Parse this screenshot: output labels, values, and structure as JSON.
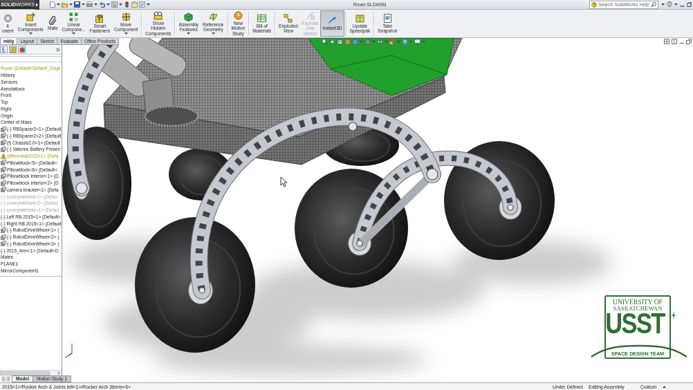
{
  "title_bar": {
    "logo": "**SOLID**WORKS",
    "title": "Rover.SLDASM",
    "search": {
      "placeholder": "Search SolidWorks Help"
    }
  },
  "command_groups": [
    [
      {
        "label": "it\nonent",
        "dropdown": false,
        "disabled": false,
        "selected": false
      },
      {
        "label": "Insert\nComponents",
        "dropdown": true,
        "disabled": false,
        "selected": false
      },
      {
        "label": "Mate",
        "dropdown": false,
        "disabled": false,
        "selected": false
      },
      {
        "label": "Linear\nCompone...",
        "dropdown": true,
        "disabled": false,
        "selected": false
      },
      {
        "label": "Smart\nFasteners",
        "dropdown": false,
        "disabled": false,
        "selected": false
      },
      {
        "label": "Move\nComponent",
        "dropdown": true,
        "disabled": false,
        "selected": false
      }
    ],
    [
      {
        "label": "Show\nHidden\nComponents",
        "dropdown": false,
        "disabled": false,
        "selected": false
      }
    ],
    [
      {
        "label": "Assembly\nFeatures",
        "dropdown": true,
        "disabled": false,
        "selected": false
      },
      {
        "label": "Reference\nGeometry",
        "dropdown": true,
        "disabled": false,
        "selected": false
      }
    ],
    [
      {
        "label": "New\nMotion\nStudy",
        "dropdown": false,
        "disabled": false,
        "selected": false
      }
    ],
    [
      {
        "label": "Bill of\nMaterials",
        "dropdown": false,
        "disabled": false,
        "selected": false
      }
    ],
    [
      {
        "label": "Exploded\nView",
        "dropdown": false,
        "disabled": false,
        "selected": false
      },
      {
        "label": "Explode\nLine\nSketch",
        "dropdown": false,
        "disabled": true,
        "selected": false
      },
      {
        "label": "Instant3D",
        "dropdown": false,
        "disabled": false,
        "selected": true
      }
    ],
    [
      {
        "label": "Update\nSpeedpak",
        "dropdown": false,
        "disabled": false,
        "selected": false
      }
    ],
    [
      {
        "label": "Take\nSnapshot",
        "dropdown": false,
        "disabled": false,
        "selected": false
      }
    ]
  ],
  "command_tabs": [
    {
      "label": "mbly",
      "selected": true
    },
    {
      "label": "Layout",
      "selected": false
    },
    {
      "label": "Sketch",
      "selected": false
    },
    {
      "label": "Evaluate",
      "selected": false
    },
    {
      "label": "Office Products",
      "selected": false
    }
  ],
  "feature_tree": {
    "items": [
      {
        "label": "Rover (Default<Default_Displ",
        "kind": "assembly",
        "suppressed": false
      },
      {
        "label": "History",
        "kind": "plain",
        "suppressed": false
      },
      {
        "label": "Sensors",
        "kind": "plain",
        "suppressed": false
      },
      {
        "label": "Annotations",
        "kind": "plain",
        "suppressed": false
      },
      {
        "label": "Front",
        "kind": "plain",
        "suppressed": false
      },
      {
        "label": "Top",
        "kind": "plain",
        "suppressed": false
      },
      {
        "label": "Right",
        "kind": "plain",
        "suppressed": false
      },
      {
        "label": "Origin",
        "kind": "plain",
        "suppressed": false
      },
      {
        "label": "Center of Mass",
        "kind": "plain",
        "suppressed": false
      },
      {
        "label": "(-) RBSpacer2<1> (Default",
        "kind": "component",
        "suppressed": false
      },
      {
        "label": "(-) RBSpacer2<2> (Default",
        "kind": "component",
        "suppressed": false
      },
      {
        "label": "(f) Chassis2.0<1> (Default",
        "kind": "component",
        "suppressed": false
      },
      {
        "label": "(-) Valence Battery Presen",
        "kind": "component",
        "suppressed": false
      },
      {
        "label": "differential2015<1> (Defa",
        "kind": "warning",
        "suppressed": false
      },
      {
        "label": "Pillowblock<5> (Default<",
        "kind": "component",
        "suppressed": false
      },
      {
        "label": "Pillowblock<6> (Default<",
        "kind": "component",
        "suppressed": false
      },
      {
        "label": "Pillowblock interior<1> (D",
        "kind": "component",
        "suppressed": false
      },
      {
        "label": "Pillowblock interior<2> (D",
        "kind": "component",
        "suppressed": false
      },
      {
        "label": "camera bracket<1> (Defa",
        "kind": "component",
        "suppressed": false
      },
      {
        "label": "(-) coverplatefwd<1> (Defau",
        "kind": "plain",
        "suppressed": true
      },
      {
        "label": "(-) coverplatefwd<2> (Defau",
        "kind": "plain",
        "suppressed": true
      },
      {
        "label": "(-) coverplateside<1> (Defau",
        "kind": "plain",
        "suppressed": true
      },
      {
        "label": "(-) Left RB 2015<1> (Default<",
        "kind": "plain",
        "suppressed": false
      },
      {
        "label": "(-) Right RB 2015<1> (Default",
        "kind": "plain",
        "suppressed": false
      },
      {
        "label": "(-) RobotDriveWheel<1> (",
        "kind": "component",
        "suppressed": false
      },
      {
        "label": "(-) RobotDriveWheel<2> (",
        "kind": "component",
        "suppressed": false
      },
      {
        "label": "(-) RobotDriveWheel<3> (",
        "kind": "component",
        "suppressed": false
      },
      {
        "label": "(-) 2015_Arm<1> (Default<D",
        "kind": "plain",
        "suppressed": false
      },
      {
        "label": "Mates",
        "kind": "plain",
        "suppressed": false
      },
      {
        "label": "PLANE1",
        "kind": "plain",
        "suppressed": false
      },
      {
        "label": "MirrorComponent1",
        "kind": "plain",
        "suppressed": false
      }
    ]
  },
  "document_tabs": [
    {
      "label": "Model",
      "selected": true
    },
    {
      "label": "Motion Study 1",
      "selected": false
    }
  ],
  "overlay_logo": {
    "lines": [
      "UNIVERSITY OF",
      "SASKATCHEWAN"
    ],
    "wordmark": "USST",
    "tagline": "SPACE DESIGN TEAM"
  },
  "status_bar": {
    "path": "2015<1>/Rocker Arch & Joints left<1>/Rocker Arch 36mm<6>",
    "fields": [
      "Under Defined",
      "Editing Assembly",
      "Custom"
    ]
  }
}
